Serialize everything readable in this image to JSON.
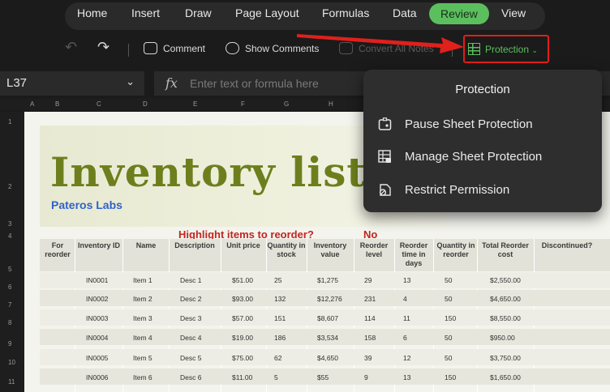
{
  "ribbon": {
    "tabs": [
      "Home",
      "Insert",
      "Draw",
      "Page Layout",
      "Formulas",
      "Data",
      "Review",
      "View"
    ],
    "active_tab": "Review"
  },
  "toolbar": {
    "comment_label": "Comment",
    "show_comments_label": "Show Comments",
    "convert_notes_label": "Convert All Notes",
    "protection_label": "Protection"
  },
  "formula_bar": {
    "cell_ref": "L37",
    "fx": "fx",
    "placeholder": "Enter text or formula here"
  },
  "columns": [
    "A",
    "B",
    "C",
    "D",
    "E",
    "F",
    "G",
    "H",
    "I",
    "J",
    "K",
    "L"
  ],
  "rows": [
    "1",
    "2",
    "3",
    "4",
    "5",
    "6",
    "7",
    "8",
    "9",
    "10",
    "11"
  ],
  "sheet": {
    "title": "Inventory list",
    "company": "Pateros Labs",
    "highlight_label": "Highlight items to reorder?",
    "highlight_value": "No",
    "headers": [
      "For reorder",
      "Inventory ID",
      "Name",
      "Description",
      "Unit price",
      "Quantity in stock",
      "Inventory value",
      "Reorder level",
      "Reorder time in days",
      "Quantity in reorder",
      "Total Reorder cost",
      "Discontinued?"
    ],
    "items": [
      {
        "id": "IN0001",
        "name": "Item 1",
        "desc": "Desc 1",
        "price": "$51.00",
        "qty": "25",
        "value": "$1,275",
        "level": "29",
        "days": "13",
        "reorder_qty": "50",
        "cost": "$2,550.00"
      },
      {
        "id": "IN0002",
        "name": "Item 2",
        "desc": "Desc 2",
        "price": "$93.00",
        "qty": "132",
        "value": "$12,276",
        "level": "231",
        "days": "4",
        "reorder_qty": "50",
        "cost": "$4,650.00"
      },
      {
        "id": "IN0003",
        "name": "Item 3",
        "desc": "Desc 3",
        "price": "$57.00",
        "qty": "151",
        "value": "$8,607",
        "level": "114",
        "days": "11",
        "reorder_qty": "150",
        "cost": "$8,550.00"
      },
      {
        "id": "IN0004",
        "name": "Item 4",
        "desc": "Desc 4",
        "price": "$19.00",
        "qty": "186",
        "value": "$3,534",
        "level": "158",
        "days": "6",
        "reorder_qty": "50",
        "cost": "$950.00"
      },
      {
        "id": "IN0005",
        "name": "Item 5",
        "desc": "Desc 5",
        "price": "$75.00",
        "qty": "62",
        "value": "$4,650",
        "level": "39",
        "days": "12",
        "reorder_qty": "50",
        "cost": "$3,750.00"
      },
      {
        "id": "IN0006",
        "name": "Item 6",
        "desc": "Desc 6",
        "price": "$11.00",
        "qty": "5",
        "value": "$55",
        "level": "9",
        "days": "13",
        "reorder_qty": "150",
        "cost": "$1,650.00"
      }
    ]
  },
  "protection_menu": {
    "title": "Protection",
    "items": [
      "Pause Sheet Protection",
      "Manage Sheet Protection",
      "Restrict Permission"
    ]
  },
  "colors": {
    "accent_green": "#5bbf5e",
    "callout_red": "#e0201c",
    "title_olive": "#6d7f1d",
    "company_blue": "#2f63c8"
  }
}
